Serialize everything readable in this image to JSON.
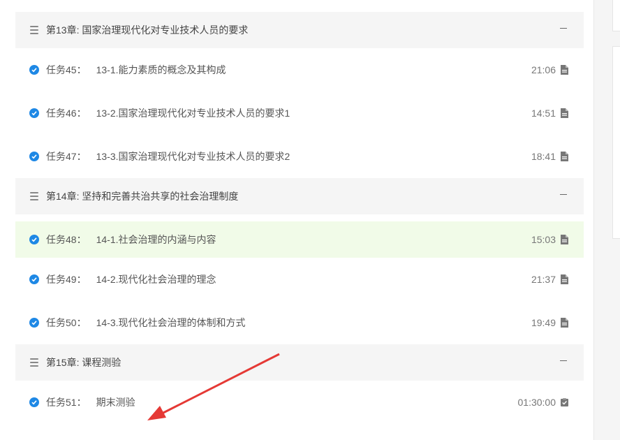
{
  "chapters": [
    {
      "title": "第13章: 国家治理现代化对专业技术人员的要求",
      "tasks": [
        {
          "num": "任务45：",
          "name": "13-1.能力素质的概念及其构成",
          "duration": "21:06",
          "icon": "document-icon"
        },
        {
          "num": "任务46：",
          "name": "13-2.国家治理现代化对专业技术人员的要求1",
          "duration": "14:51",
          "icon": "document-icon"
        },
        {
          "num": "任务47：",
          "name": "13-3.国家治理现代化对专业技术人员的要求2",
          "duration": "18:41",
          "icon": "document-icon"
        }
      ]
    },
    {
      "title": "第14章: 坚持和完善共治共享的社会治理制度",
      "tasks": [
        {
          "num": "任务48：",
          "name": "14-1.社会治理的内涵与内容",
          "duration": "15:03",
          "icon": "document-icon"
        },
        {
          "num": "任务49：",
          "name": "14-2.现代化社会治理的理念",
          "duration": "21:37",
          "icon": "document-icon"
        },
        {
          "num": "任务50：",
          "name": "14-3.现代化社会治理的体制和方式",
          "duration": "19:49",
          "icon": "document-icon"
        }
      ]
    },
    {
      "title": "第15章: 课程测验",
      "tasks": [
        {
          "num": "任务51：",
          "name": "期末测验",
          "duration": "01:30:00",
          "icon": "exam-icon"
        }
      ]
    }
  ],
  "active_task": "任务48：",
  "colors": {
    "check": "#1e88e5",
    "active_bg": "#f1fbe8",
    "chapter_bg": "#f5f5f5",
    "arrow": "#e53935"
  }
}
